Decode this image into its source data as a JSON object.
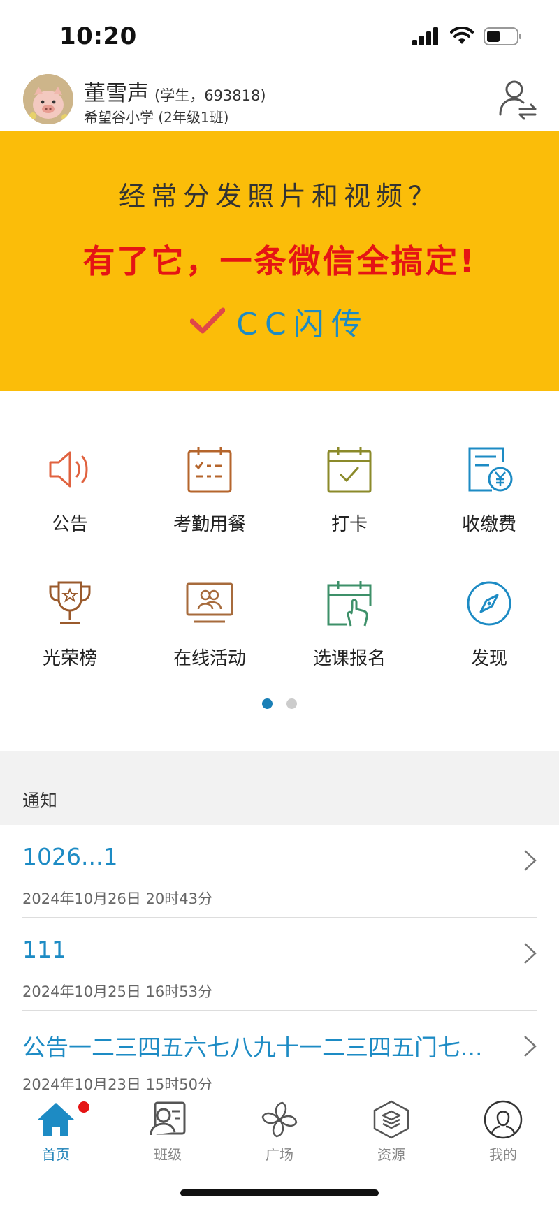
{
  "status_bar": {
    "time": "10:20"
  },
  "profile": {
    "name": "董雪声",
    "meta": "(学生，693818)",
    "school": "希望谷小学 (2年级1班)"
  },
  "banner": {
    "line1": "经常分发照片和视频？",
    "line2": "有了它，一条微信全搞定!",
    "brand": "CC闪传",
    "bg_color": "#fbbd09",
    "highlight_color": "#e51414",
    "brand_color": "#1d8bc4"
  },
  "features": {
    "items": [
      {
        "label": "公告",
        "icon": "speaker-icon"
      },
      {
        "label": "考勤用餐",
        "icon": "calendar-list-icon"
      },
      {
        "label": "打卡",
        "icon": "calendar-check-icon"
      },
      {
        "label": "收缴费",
        "icon": "payment-doc-icon"
      },
      {
        "label": "光荣榜",
        "icon": "trophy-icon"
      },
      {
        "label": "在线活动",
        "icon": "monitor-people-icon"
      },
      {
        "label": "选课报名",
        "icon": "calendar-hand-icon"
      },
      {
        "label": "发现",
        "icon": "compass-icon"
      }
    ],
    "page_count": 2,
    "current_page": 1
  },
  "notices": {
    "header": "通知",
    "items": [
      {
        "title": "1026...1",
        "date": "2024年10月26日 20时43分"
      },
      {
        "title": "111",
        "date": "2024年10月25日 16时53分"
      },
      {
        "title": "公告一二三四五六七八九十一二三四五门七...",
        "date": "2024年10月23日 15时50分"
      }
    ]
  },
  "tabbar": {
    "items": [
      {
        "label": "首页",
        "icon": "home-icon",
        "active": true,
        "badge": true
      },
      {
        "label": "班级",
        "icon": "class-icon",
        "active": false
      },
      {
        "label": "广场",
        "icon": "pinwheel-icon",
        "active": false
      },
      {
        "label": "资源",
        "icon": "layers-icon",
        "active": false
      },
      {
        "label": "我的",
        "icon": "user-icon",
        "active": false
      }
    ],
    "active_color": "#1a7fb6"
  }
}
